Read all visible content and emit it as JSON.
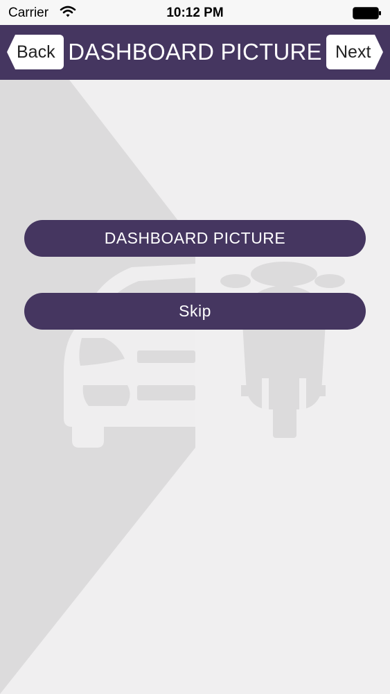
{
  "status_bar": {
    "carrier": "Carrier",
    "time": "10:12 PM"
  },
  "nav": {
    "back_label": "Back",
    "title": "DASHBOARD PICTURE",
    "next_label": "Next"
  },
  "actions": {
    "dashboard_picture_label": "DASHBOARD PICTURE",
    "skip_label": "Skip"
  },
  "colors": {
    "nav_background": "#453660",
    "button_background": "#453660",
    "page_background": "#f0eff0",
    "diagonal_panel": "#dcdbdc"
  },
  "background_icons": [
    "car-icon",
    "motorcycle-icon"
  ]
}
